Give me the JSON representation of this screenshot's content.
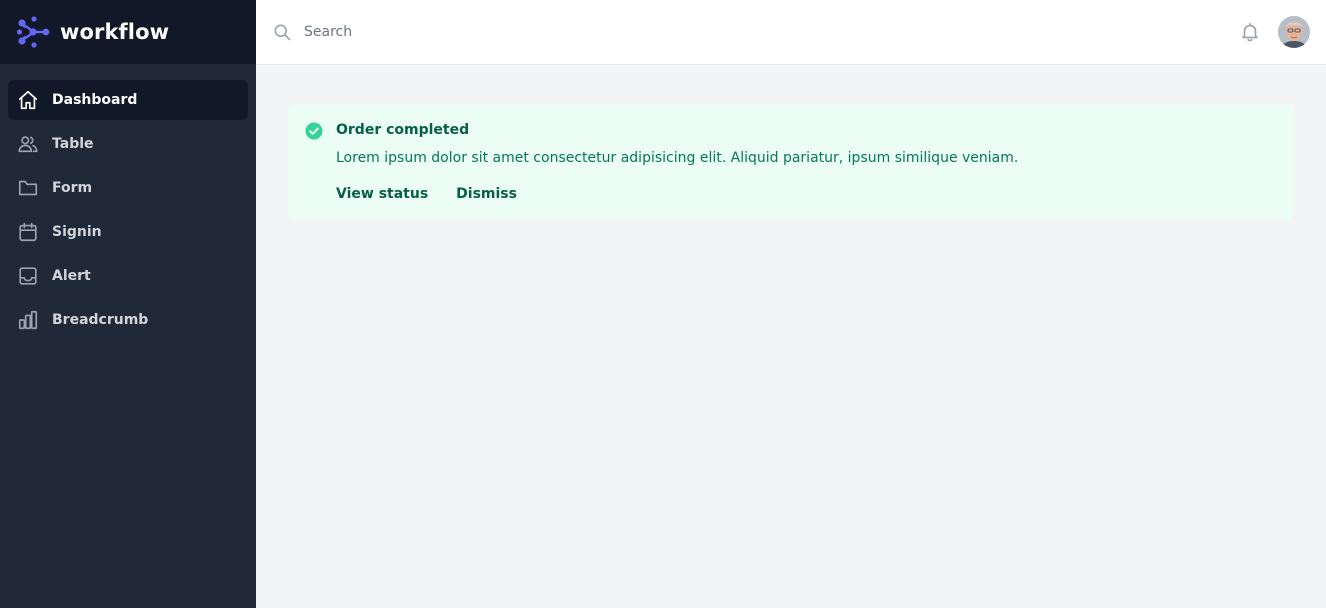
{
  "brand": {
    "name": "workflow",
    "icon": "workflow-logo"
  },
  "sidebar": {
    "items": [
      {
        "label": "Dashboard",
        "icon": "home-icon",
        "active": true
      },
      {
        "label": "Table",
        "icon": "users-icon",
        "active": false
      },
      {
        "label": "Form",
        "icon": "folder-icon",
        "active": false
      },
      {
        "label": "Signin",
        "icon": "calendar-icon",
        "active": false
      },
      {
        "label": "Alert",
        "icon": "inbox-icon",
        "active": false
      },
      {
        "label": "Breadcrumb",
        "icon": "chart-bar-icon",
        "active": false
      }
    ]
  },
  "header": {
    "search": {
      "placeholder": "Search",
      "value": ""
    },
    "notifications_icon": "bell-icon",
    "avatar_icon": "user-avatar"
  },
  "alert": {
    "icon": "check-circle-icon",
    "title": "Order completed",
    "description": "Lorem ipsum dolor sit amet consectetur adipisicing elit. Aliquid pariatur, ipsum similique veniam.",
    "actions": {
      "view_status": "View status",
      "dismiss": "Dismiss"
    }
  },
  "colors": {
    "sidebar_bg": "#1f2937",
    "brand_bg": "#111827",
    "accent": "#6366f1",
    "alert_bg": "#ecfdf5",
    "alert_icon": "#34d399",
    "alert_text": "#065f46",
    "alert_desc": "#047857",
    "page_bg": "#f3f4f6"
  }
}
